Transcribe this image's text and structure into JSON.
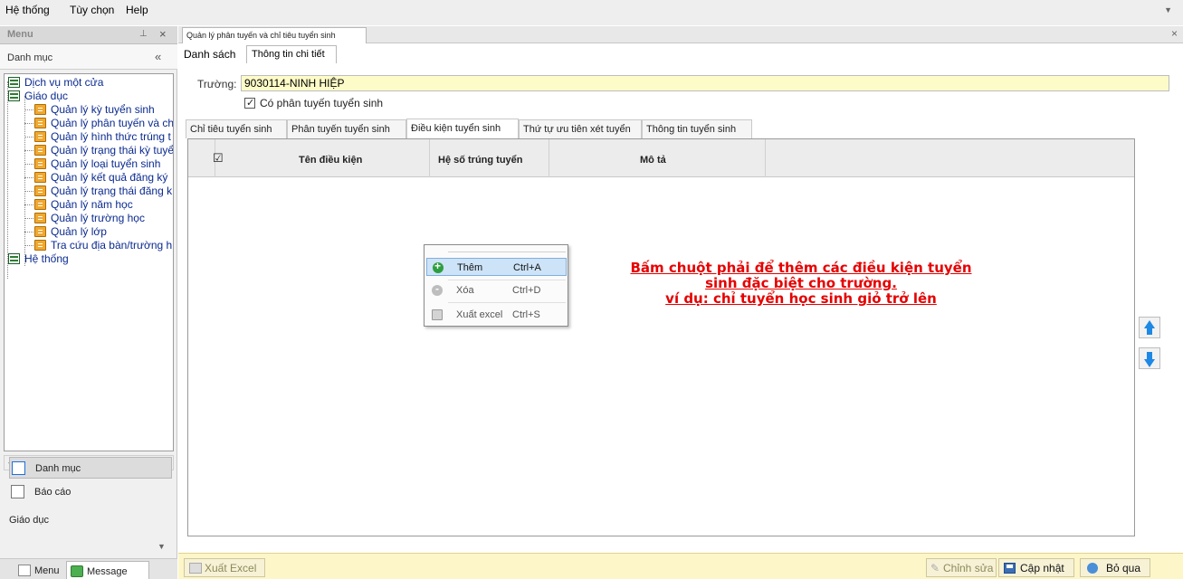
{
  "menubar": {
    "items": [
      "Hệ thống",
      "Tùy chọn",
      "Help"
    ]
  },
  "left_panel": {
    "title": "Menu",
    "category_header": "Danh mục",
    "tree": {
      "root1": "Dịch vụ một cửa",
      "root2": "Giáo dục",
      "children": [
        "Quản lý kỳ tuyển sinh",
        "Quản lý phân tuyến và ch",
        "Quản lý hình thức trúng t",
        "Quản lý trạng thái kỳ tuyể",
        "Quản lý loại tuyển sinh",
        "Quản lý kết quả đăng ký",
        "Quản lý trạng thái đăng k",
        "Quản lý năm học",
        "Quản lý trường học",
        "Quản lý lớp",
        "Tra cứu địa bàn/trường h"
      ],
      "root3": "Hệ thống"
    },
    "nav": {
      "danhmuc": "Danh mục",
      "baocao": "Báo cáo",
      "group": "Giáo dục"
    },
    "bottom_tabs": {
      "menu": "Menu",
      "message": "Message"
    }
  },
  "document": {
    "tab_title": "Quản lý phân tuyến và chỉ tiêu tuyển sinh",
    "subtabs": {
      "list": "Danh sách",
      "detail": "Thông tin chi tiết"
    },
    "school_label": "Trường:",
    "school_value": "9030114-NINH HIỆP",
    "checkbox_label": "Có phân tuyến tuyển sinh",
    "inner_tabs": [
      "Chỉ tiêu tuyển sinh",
      "Phân tuyến tuyển sinh",
      "Điều kiện tuyển sinh",
      "Thứ tự ưu tiên xét tuyển",
      "Thông tin tuyển sinh"
    ],
    "grid_headers": {
      "check": "☑",
      "name": "Tên điều kiện",
      "coef": "Hệ số trúng tuyển",
      "desc": "Mô tả"
    },
    "hint": "Bấm chuột phải để thêm các điều kiện tuyển sinh đặc biệt cho trường.",
    "hint2": "ví dụ: chỉ tuyển học sinh giỏ trở lên"
  },
  "context_menu": {
    "add": {
      "label": "Thêm",
      "shortcut": "Ctrl+A"
    },
    "delete": {
      "label": "Xóa",
      "shortcut": "Ctrl+D"
    },
    "export": {
      "label": "Xuất excel",
      "shortcut": "Ctrl+S"
    }
  },
  "bottom_bar": {
    "export": "Xuất Excel",
    "edit": "Chỉnh sửa",
    "update": "Cập nhật",
    "skip": "Bỏ qua"
  }
}
